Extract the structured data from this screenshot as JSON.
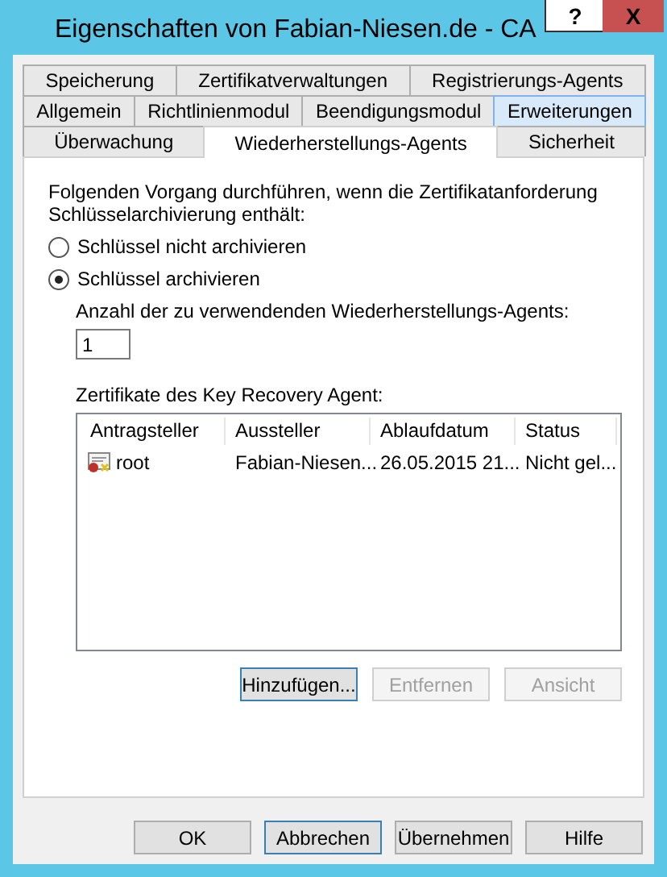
{
  "window": {
    "title": "Eigenschaften von Fabian-Niesen.de - CA",
    "help": "?",
    "close": "X"
  },
  "tab_rows": [
    [
      {
        "label": "Speicherung",
        "selected": false,
        "highlighted": false
      },
      {
        "label": "Zertifikatverwaltungen",
        "selected": false,
        "highlighted": false
      },
      {
        "label": "Registrierungs-Agents",
        "selected": false,
        "highlighted": false
      }
    ],
    [
      {
        "label": "Allgemein",
        "selected": false,
        "highlighted": false
      },
      {
        "label": "Richtlinienmodul",
        "selected": false,
        "highlighted": false
      },
      {
        "label": "Beendigungsmodul",
        "selected": false,
        "highlighted": false
      },
      {
        "label": "Erweiterungen",
        "selected": false,
        "highlighted": true
      }
    ],
    [
      {
        "label": "Überwachung",
        "selected": false,
        "highlighted": false
      },
      {
        "label": "Wiederherstellungs-Agents",
        "selected": true,
        "highlighted": false
      },
      {
        "label": "Sicherheit",
        "selected": false,
        "highlighted": false
      }
    ]
  ],
  "intro": "Folgenden Vorgang durchführen, wenn die Zertifikatanforderung Schlüsselarchivierung enthält:",
  "options": [
    {
      "label": "Schlüssel nicht archivieren",
      "selected": false
    },
    {
      "label": "Schlüssel archivieren",
      "selected": true
    }
  ],
  "agent_count": {
    "label": "Anzahl der zu verwendenden Wiederherstellungs-Agents:",
    "value": "1"
  },
  "certificates": {
    "label": "Zertifikate des Key Recovery Agent:",
    "columns": [
      "Antragsteller",
      "Aussteller",
      "Ablaufdatum",
      "Status"
    ],
    "rows": [
      [
        "root",
        "Fabian-Niesen...",
        "26.05.2015 21...",
        "Nicht gel..."
      ]
    ]
  },
  "list_buttons": [
    {
      "label": "Hinzufügen...",
      "disabled": false,
      "default": true
    },
    {
      "label": "Entfernen",
      "disabled": true,
      "default": false
    },
    {
      "label": "Ansicht",
      "disabled": true,
      "default": false
    }
  ],
  "buttons": [
    {
      "label": "OK",
      "default": false
    },
    {
      "label": "Abbrechen",
      "default": true
    },
    {
      "label": "Übernehmen",
      "default": false
    },
    {
      "label": "Hilfe",
      "default": false
    }
  ]
}
